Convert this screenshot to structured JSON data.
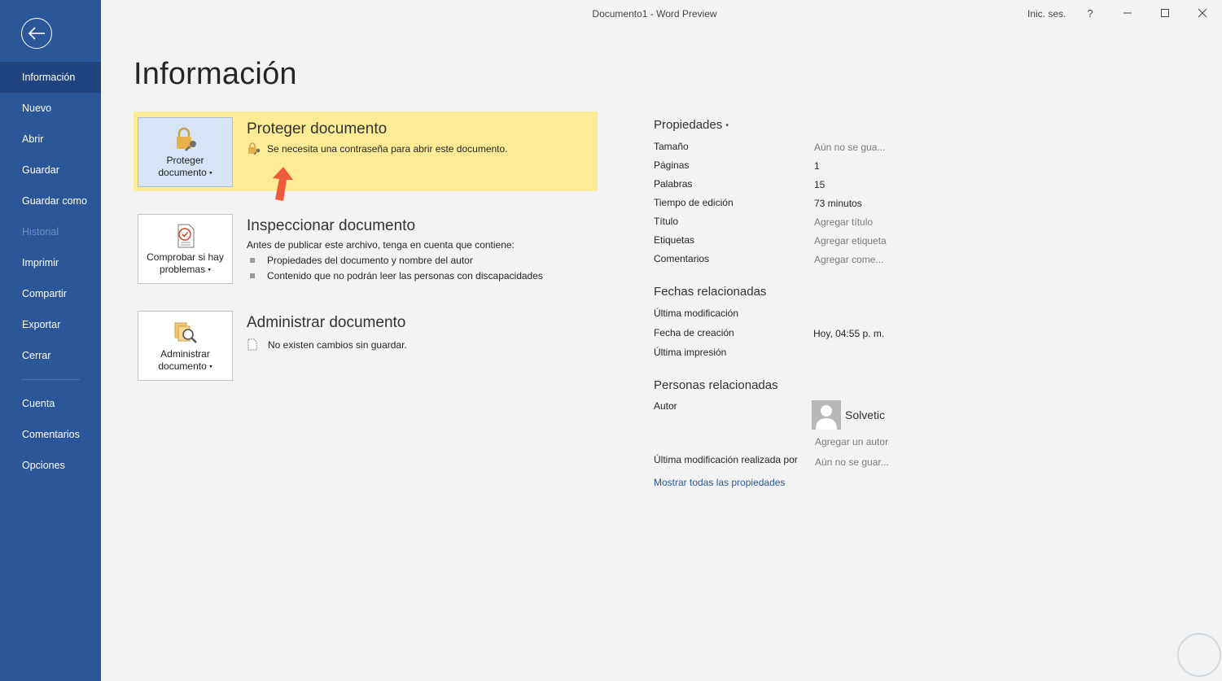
{
  "window": {
    "title": "Documento1  -  Word Preview",
    "signin": "Inic. ses.",
    "help": "?"
  },
  "sidebar": {
    "items": [
      {
        "label": "Información"
      },
      {
        "label": "Nuevo"
      },
      {
        "label": "Abrir"
      },
      {
        "label": "Guardar"
      },
      {
        "label": "Guardar como"
      },
      {
        "label": "Historial"
      },
      {
        "label": "Imprimir"
      },
      {
        "label": "Compartir"
      },
      {
        "label": "Exportar"
      },
      {
        "label": "Cerrar"
      },
      {
        "label": "Cuenta"
      },
      {
        "label": "Comentarios"
      },
      {
        "label": "Opciones"
      }
    ]
  },
  "main": {
    "title": "Información",
    "protect": {
      "tile_line1": "Proteger",
      "tile_line2": "documento",
      "title": "Proteger documento",
      "text": "Se necesita una contraseña para abrir este documento."
    },
    "inspect": {
      "tile_line1": "Comprobar si hay",
      "tile_line2": "problemas",
      "title": "Inspeccionar documento",
      "text": "Antes de publicar este archivo, tenga en cuenta que contiene:",
      "bullets": [
        "Propiedades del documento y nombre del autor",
        "Contenido que no podrán leer las personas con discapacidades"
      ]
    },
    "manage": {
      "tile_line1": "Administrar",
      "tile_line2": "documento",
      "title": "Administrar documento",
      "text": "No existen cambios sin guardar."
    }
  },
  "properties": {
    "heading": "Propiedades",
    "rows": [
      {
        "label": "Tamaño",
        "value": "Aún no se gua..."
      },
      {
        "label": "Páginas",
        "value": "1"
      },
      {
        "label": "Palabras",
        "value": "15"
      },
      {
        "label": "Tiempo de edición",
        "value": "73 minutos"
      },
      {
        "label": "Título",
        "value": "Agregar título"
      },
      {
        "label": "Etiquetas",
        "value": "Agregar etiqueta"
      },
      {
        "label": "Comentarios",
        "value": "Agregar come..."
      }
    ],
    "dates_heading": "Fechas relacionadas",
    "dates": [
      {
        "label": "Última modificación",
        "value": ""
      },
      {
        "label": "Fecha de creación",
        "value": "Hoy, 04:55 p. m."
      },
      {
        "label": "Última impresión",
        "value": ""
      }
    ],
    "people_heading": "Personas relacionadas",
    "author_label": "Autor",
    "author_name": "Solvetic",
    "add_author": "Agregar un autor",
    "last_modified_by_label": "Última modificación realizada por",
    "last_modified_by_value": "Aún no se guar...",
    "show_all": "Mostrar todas las propiedades"
  },
  "colors": {
    "sidebar": "#2b579a",
    "highlight": "#fdeb96",
    "accent_arrow": "#f05a3c"
  }
}
